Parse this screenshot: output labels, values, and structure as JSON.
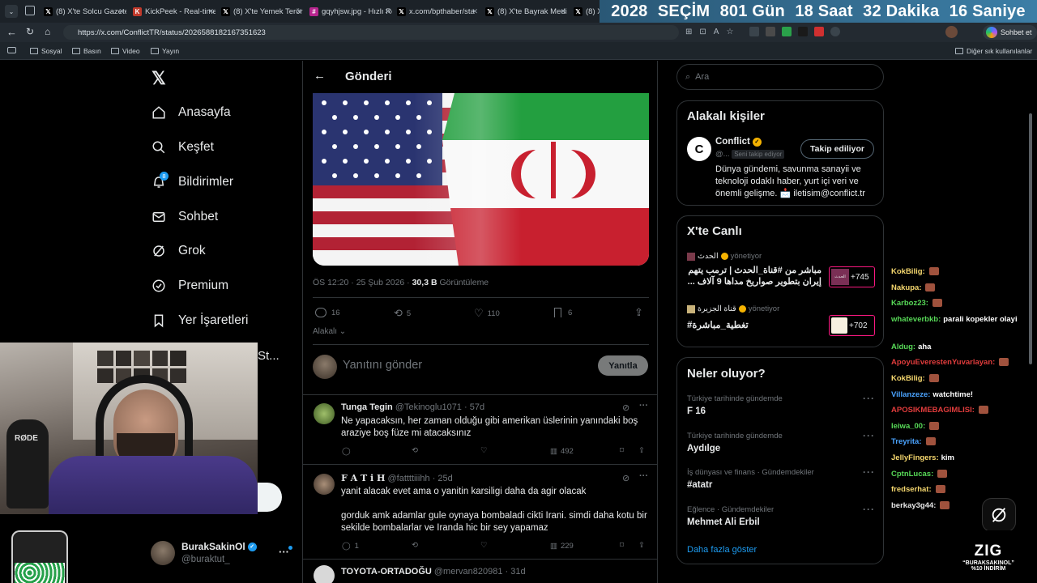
{
  "browser": {
    "tabs": [
      {
        "label": "(8) X'te Solcu Gazete",
        "favicon": "x"
      },
      {
        "label": "KickPeek - Real-time",
        "favicon": "kickpeek"
      },
      {
        "label": "(8) X'te Yemek Terör",
        "favicon": "x"
      },
      {
        "label": "gqyhjsw.jpg - Hızlı Re",
        "favicon": "image"
      },
      {
        "label": "x.com/bpthaber/sta",
        "favicon": "x"
      },
      {
        "label": "(8) X'te Bayrak Medi",
        "favicon": "x"
      },
      {
        "label": "(8) X",
        "favicon": "x"
      }
    ],
    "countdown": {
      "year": "2028",
      "label": "SEÇİM",
      "days": "801 Gün",
      "hours": "18 Saat",
      "minutes": "32 Dakika",
      "seconds": "16 Saniye"
    },
    "url": "https://x.com/ConflictTR/status/2026588182167351623",
    "chat_button": "Sohbet et",
    "bookmarks": [
      "Sosyal",
      "Basın",
      "Video",
      "Yayın"
    ],
    "other_bookmarks": "Diğer sık kullanılanlar"
  },
  "sidebar": {
    "items": [
      {
        "label": "Anasayfa",
        "icon": "home-icon"
      },
      {
        "label": "Keşfet",
        "icon": "search-icon"
      },
      {
        "label": "Bildirimler",
        "icon": "bell-icon",
        "badge": "8"
      },
      {
        "label": "Sohbet",
        "icon": "mail-icon"
      },
      {
        "label": "Grok",
        "icon": "grok-icon"
      },
      {
        "label": "Premium",
        "icon": "premium-icon"
      },
      {
        "label": "Yer İşaretleri",
        "icon": "bookmark-icon"
      }
    ],
    "partial_item": "St...",
    "account": {
      "name": "BurakSakinOl",
      "handle": "@buraktut_"
    }
  },
  "post": {
    "header": "Gönderi",
    "meta_time": "ÖS 12:20 · 25 Şub 2026 · ",
    "views": "30,3 B",
    "views_label": "Görüntüleme",
    "stats": {
      "replies": "16",
      "reposts": "5",
      "likes": "110",
      "bookmarks": "6"
    },
    "sort_label": "Alakalı",
    "reply_placeholder": "Yanıtını gönder",
    "reply_button": "Yanıtla"
  },
  "replies": [
    {
      "name": "Tunga Tegin",
      "handle": "@Tekinoglu1071",
      "time": "· 57d",
      "text": "Ne yapacaksın, her zaman olduğu gibi amerikan üslerinin yanındaki boş\naraziye boş füze mi atacaksınız",
      "views": "492",
      "reply_count": "",
      "like_count": ""
    },
    {
      "name": "F A T i H",
      "handle": "@fattttiiihh",
      "time": "· 25d",
      "text": "yanit alacak evet ama o yanitin karsiligi daha da agir olacak\n\ngorduk amk adamlar gule oynaya bombaladi cikti Irani. simdi daha kotu bir\nsekilde bombalarlar ve Iranda hic bir sey yapamaz",
      "views": "229",
      "reply_count": "1",
      "like_count": ""
    },
    {
      "name": "TOYOTA-ORTADOĞU",
      "handle": "@mervan820981",
      "time": "· 31d",
      "text": "",
      "views": ""
    }
  ],
  "right": {
    "search_placeholder": "Ara",
    "related_title": "Alakalı kişiler",
    "related": {
      "name": "Conflict",
      "handle": "@...",
      "follows_you": "Seni takip ediyor",
      "button": "Takip ediliyor",
      "bio": "Dünya gündemi, savunma sanayii ve teknoloji odaklı haber, yurt içi veri ve önemli gelişme. 📩 iletisim@conflict.tr"
    },
    "live_title": "X'te Canlı",
    "live": [
      {
        "host": "الحدث",
        "status": "yönetiyor",
        "title": "مباشر من #قناة_الحدث | ترمب يتهم إيران بتطوير صواريخ مداها 9 آلاف ...",
        "count": "+745"
      },
      {
        "host": "قناة الجزيرة",
        "status": "yönetiyor",
        "title": "#تغطية_مباشرة",
        "count": "+702"
      }
    ],
    "trends_title": "Neler oluyor?",
    "trends": [
      {
        "category": "Türkiye tarihinde gündemde",
        "name": "F 16"
      },
      {
        "category": "Türkiye tarihinde gündemde",
        "name": "Aydılge"
      },
      {
        "category": "İş dünyası ve finans · Gündemdekiler",
        "name": "#atatr"
      },
      {
        "category": "Eğlence · Gündemdekiler",
        "name": "Mehmet Ali Erbil"
      }
    ],
    "show_more": "Daha fazla göster"
  },
  "chat": [
    {
      "user": "KokBilig:",
      "msg": "",
      "color": "#f5d76e"
    },
    {
      "user": "Nakupa:",
      "msg": "",
      "color": "#f5d76e"
    },
    {
      "user": "Karboz23:",
      "msg": "",
      "color": "#57d957"
    },
    {
      "user": "whateverbkb:",
      "msg": "parali kopekler olayi",
      "color": "#57d957"
    },
    {
      "user": "Aldug:",
      "msg": "aha",
      "color": "#57d957"
    },
    {
      "user": "ApoyuEverestenYuvarlayan:",
      "msg": "",
      "color": "#e03c3c"
    },
    {
      "user": "KokBilig:",
      "msg": "",
      "color": "#f5d76e"
    },
    {
      "user": "Villanzeze:",
      "msg": "watchtime!",
      "color": "#4aa3ff"
    },
    {
      "user": "APOSIKMEBAGIMLISI:",
      "msg": "",
      "color": "#e03c3c"
    },
    {
      "user": "leiwa_00:",
      "msg": "",
      "color": "#57d957"
    },
    {
      "user": "Treyrita:",
      "msg": "",
      "color": "#4aa3ff"
    },
    {
      "user": "JellyFingers:",
      "msg": "kim",
      "color": "#f5d76e"
    },
    {
      "user": "CptnLucas:",
      "msg": "",
      "color": "#57d957"
    },
    {
      "user": "fredserhat:",
      "msg": "",
      "color": "#f5d76e"
    },
    {
      "user": "berkay3g44:",
      "msg": "",
      "color": "#e8e8e8"
    }
  ],
  "promo": {
    "logo": "ZIG",
    "line1": "“BURAKSAKINOL”",
    "line2": "%10 İNDİRİM"
  },
  "colors": {
    "accent": "#1d9bf0",
    "verified": "#f5b301",
    "countdown": "#2f6a8f",
    "live": "#f91880"
  }
}
